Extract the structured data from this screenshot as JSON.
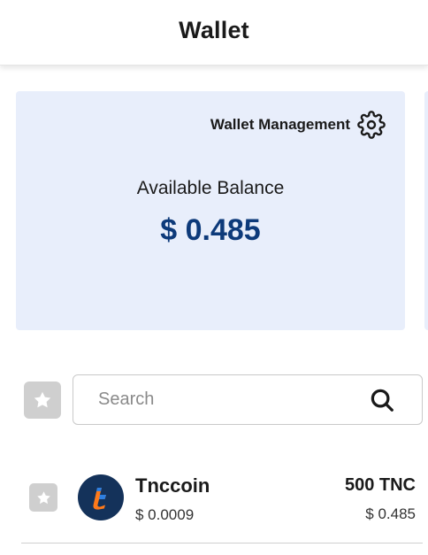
{
  "header": {
    "title": "Wallet"
  },
  "balance_card": {
    "management_label": "Wallet Management",
    "balance_label": "Available Balance",
    "balance_value": "$ 0.485",
    "background": "#e8eefb",
    "accent": "#0d3a7a"
  },
  "search": {
    "placeholder": "Search",
    "value": ""
  },
  "coins": [
    {
      "name": "Tnccoin",
      "price": "$ 0.0009",
      "amount": "500 TNC",
      "value": "$ 0.485",
      "icon": "tnccoin-logo"
    }
  ]
}
